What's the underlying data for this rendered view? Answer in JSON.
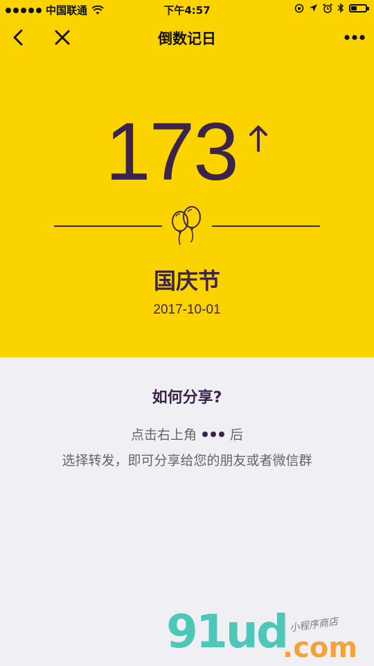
{
  "status_bar": {
    "carrier": "中国联通",
    "time": "下午4:57",
    "battery_level": 0.4
  },
  "nav": {
    "title": "倒数记日",
    "back_icon": "chevron-left-icon",
    "close_icon": "close-icon",
    "more_icon": "more-dots-icon"
  },
  "countdown": {
    "days": "173",
    "direction_icon": "arrow-up-icon"
  },
  "event": {
    "name": "国庆节",
    "date": "2017-10-01",
    "icon": "balloons-icon"
  },
  "share": {
    "title": "如何分享?",
    "line1_prefix": "点击右上角",
    "line1_suffix": "后",
    "line2": "选择转发，即可分享给您的朋友或者微信群"
  },
  "watermark": {
    "brand": "91ud",
    "domain": ".com",
    "tagline": "小程序商店"
  },
  "colors": {
    "header_bg": "#fbd400",
    "accent": "#3b2349",
    "page_bg": "#efeff4"
  }
}
